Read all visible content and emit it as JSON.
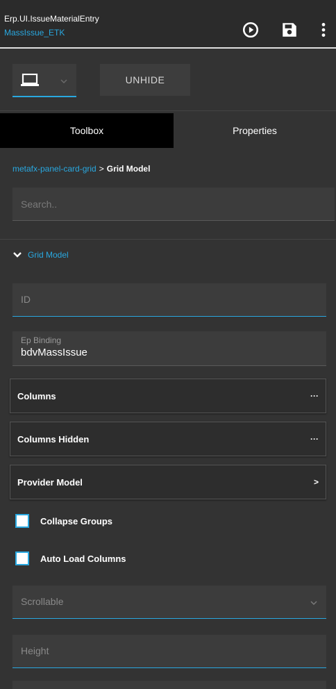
{
  "header": {
    "title": "Erp.UI.IssueMaterialEntry",
    "subtitle": "MassIssue_ETK",
    "icons": [
      "play-circle-icon",
      "save-icon",
      "more-vert-icon"
    ]
  },
  "toolbar": {
    "device_icon": "laptop-icon",
    "unhide_label": "UNHIDE"
  },
  "tabs": [
    {
      "label": "Toolbox",
      "active": true
    },
    {
      "label": "Properties",
      "active": false
    }
  ],
  "breadcrumb": {
    "parent": "metafx-panel-card-grid",
    "separator": ">",
    "current": "Grid Model"
  },
  "search": {
    "placeholder": "Search.."
  },
  "section": {
    "title": "Grid Model",
    "expanded": true
  },
  "fields": {
    "id": {
      "placeholder": "ID"
    },
    "ep_binding": {
      "label": "Ep Binding",
      "value": "bdvMassIssue"
    },
    "scrollable": {
      "placeholder": "Scrollable"
    },
    "height": {
      "placeholder": "Height"
    }
  },
  "cards": {
    "columns": {
      "label": "Columns",
      "action": "···"
    },
    "columns_hidden": {
      "label": "Columns Hidden",
      "action": "···"
    },
    "provider_model": {
      "label": "Provider Model",
      "action": ">"
    }
  },
  "checkboxes": {
    "collapse_groups": {
      "label": "Collapse Groups",
      "checked": false
    },
    "auto_load_columns": {
      "label": "Auto Load Columns",
      "checked": false
    }
  },
  "colors": {
    "accent": "#29a8e0",
    "background": "#333333",
    "active_tab": "#000000"
  }
}
